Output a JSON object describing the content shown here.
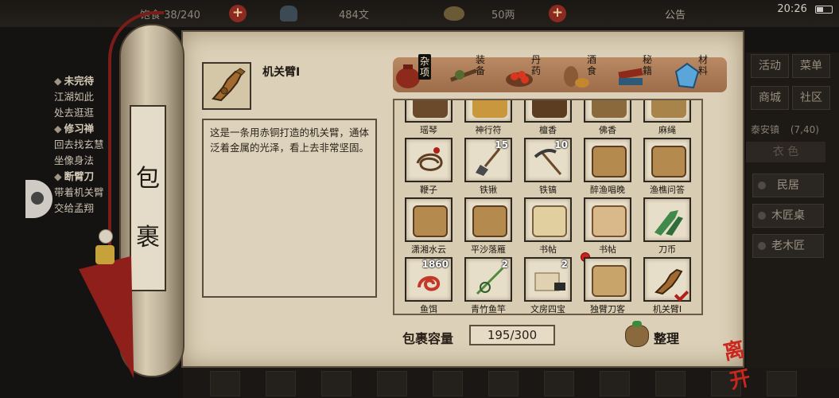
{
  "status_bar": {
    "satiety": "饱食 38/240",
    "copper": "484文",
    "silver": "50两",
    "announcement": "公告",
    "time": "20:26"
  },
  "quest_log": [
    {
      "title": "未完待",
      "lines": [
        "江湖如此",
        "处去逛逛"
      ]
    },
    {
      "title": "修习禅",
      "lines": [
        "回去找玄慧",
        "坐像身法"
      ]
    },
    {
      "title": "断臂刀",
      "lines": [
        "带着机关臂",
        "交给孟翔"
      ]
    }
  ],
  "right_menu": {
    "buttons": [
      "活动",
      "菜单",
      "商城",
      "社区"
    ],
    "town": "泰安镇",
    "coords": "(7,40)",
    "current": "衣 色",
    "rows": [
      "民居",
      "木匠桌",
      "老木匠"
    ]
  },
  "scroll_title": "包裹",
  "selected_item": {
    "name": "机关臂I",
    "description": "这是一条用赤铜打造的机关臂，通体泛着金属的光泽，看上去非常坚固。"
  },
  "tabs": [
    {
      "label": "杂项",
      "icon": "jar-icon",
      "active": true
    },
    {
      "label": "装备",
      "icon": "weapon-icon",
      "active": false
    },
    {
      "label": "丹药",
      "icon": "pill-plate-icon",
      "active": false
    },
    {
      "label": "酒食",
      "icon": "food-icon",
      "active": false
    },
    {
      "label": "秘籍",
      "icon": "books-icon",
      "active": false
    },
    {
      "label": "材料",
      "icon": "crystal-icon",
      "active": false
    }
  ],
  "items": [
    {
      "name": "瑶琴",
      "count": "",
      "icon": "zither-icon"
    },
    {
      "name": "神行符",
      "count": "",
      "icon": "talisman-icon"
    },
    {
      "name": "檀香",
      "count": "",
      "icon": "incense-icon"
    },
    {
      "name": "佛香",
      "count": "",
      "icon": "joss-stick-icon"
    },
    {
      "name": "麻绳",
      "count": "",
      "icon": "hemp-rope-icon"
    },
    {
      "name": "鞭子",
      "count": "",
      "icon": "whip-icon"
    },
    {
      "name": "铁锹",
      "count": "15",
      "icon": "shovel-icon"
    },
    {
      "name": "铁镐",
      "count": "10",
      "icon": "pickaxe-icon"
    },
    {
      "name": "醉渔唱晚",
      "count": "",
      "icon": "music-book-icon"
    },
    {
      "name": "渔樵问答",
      "count": "",
      "icon": "music-book-icon"
    },
    {
      "name": "潇湘水云",
      "count": "",
      "icon": "music-book-icon"
    },
    {
      "name": "平沙落雁",
      "count": "",
      "icon": "music-book-icon"
    },
    {
      "name": "书帖",
      "count": "",
      "icon": "calligraphy-icon"
    },
    {
      "name": "书帖",
      "count": "",
      "icon": "calligraphy-icon"
    },
    {
      "name": "刀币",
      "count": "",
      "icon": "coin-knife-icon"
    },
    {
      "name": "鱼饵",
      "count": "1860",
      "icon": "worm-bait-icon"
    },
    {
      "name": "青竹鱼竿",
      "count": "2",
      "icon": "fishing-rod-icon"
    },
    {
      "name": "文房四宝",
      "count": "2",
      "icon": "brush-set-icon"
    },
    {
      "name": "独臂刀客",
      "count": "",
      "icon": "book-icon",
      "new": true
    },
    {
      "name": "机关臂I",
      "count": "",
      "icon": "mechanical-arm-icon",
      "selected": true
    }
  ],
  "capacity": {
    "label": "包裹容量",
    "value": "195/300"
  },
  "sort_button": "整理",
  "close_button": "离开",
  "colors": {
    "paper": "#dcd1b8",
    "tab_bar": "#a8744f",
    "accent_red": "#b0201a"
  }
}
